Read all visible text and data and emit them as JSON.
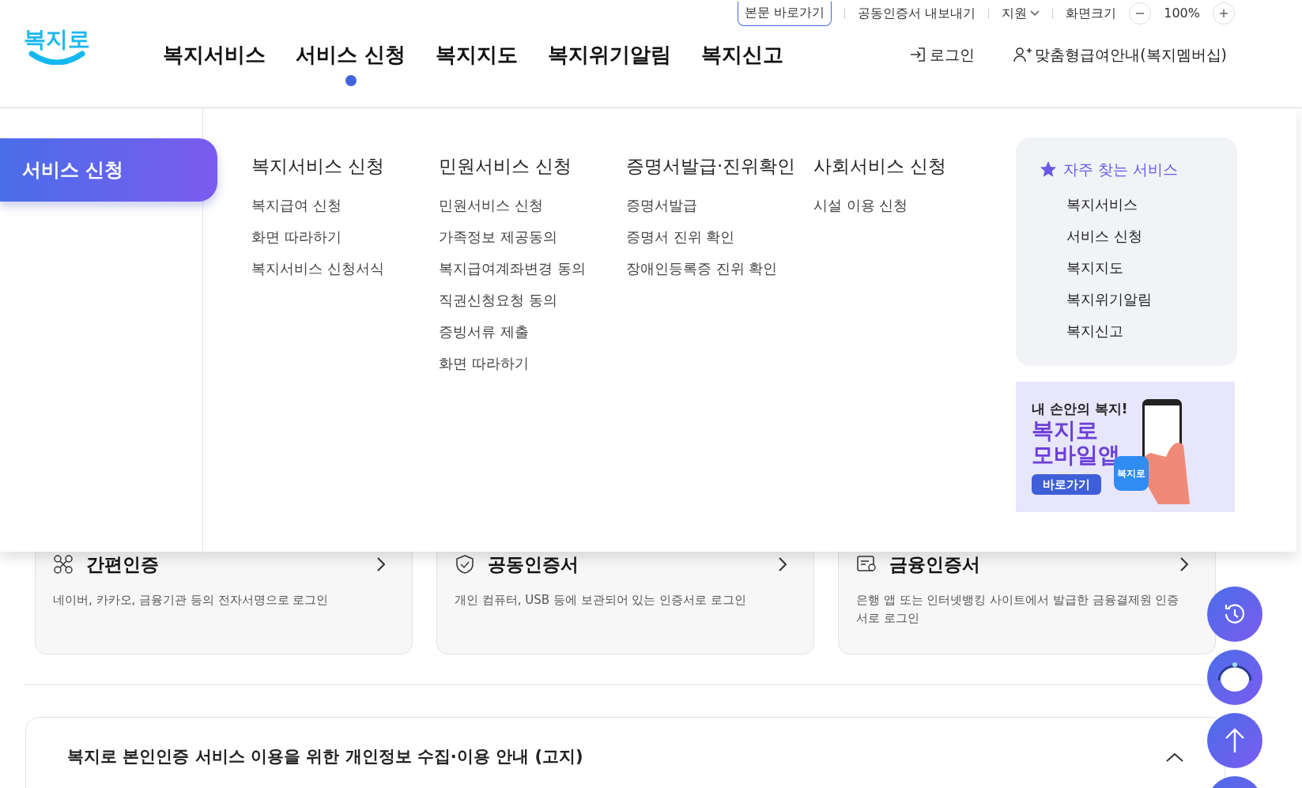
{
  "utility_bar": {
    "skip_link": "본문 바로가기",
    "export_link": "공동인증서 내보내기",
    "support": "지원",
    "zoom_label": "화면크기",
    "zoom_value": "100%"
  },
  "logo": "복지로",
  "nav": [
    {
      "label": "복지서비스",
      "selected": false
    },
    {
      "label": "서비스 신청",
      "selected": true
    },
    {
      "label": "복지지도",
      "selected": false
    },
    {
      "label": "복지위기알림",
      "selected": false
    },
    {
      "label": "복지신고",
      "selected": false
    }
  ],
  "account": [
    {
      "kind": "login",
      "label": "로그인"
    },
    {
      "kind": "member",
      "label": "맞춤형급여안내(복지멤버십)"
    }
  ],
  "mega_menu": {
    "title": "서비스 신청",
    "columns": [
      {
        "heading": "복지서비스 신청",
        "items": [
          "복지급여 신청",
          "화면 따라하기",
          "복지서비스 신청서식"
        ]
      },
      {
        "heading": "민원서비스 신청",
        "items": [
          "민원서비스 신청",
          "가족정보 제공동의",
          "복지급여계좌변경 동의",
          "직권신청요청 동의",
          "증빙서류 제출",
          "화면 따라하기"
        ]
      },
      {
        "heading": "증명서발급·진위확인",
        "items": [
          "증명서발급",
          "증명서 진위 확인",
          "장애인등록증 진위 확인"
        ]
      },
      {
        "heading": "사회서비스 신청",
        "items": [
          "시설 이용 신청"
        ]
      }
    ]
  },
  "favorites": {
    "title": "자주 찾는 서비스",
    "items": [
      "복지서비스",
      "서비스 신청",
      "복지지도",
      "복지위기알림",
      "복지신고"
    ]
  },
  "banner": {
    "kicker": "내 손안의 복지!",
    "headline": [
      "복지로",
      "모바일앱"
    ],
    "button": "바로가기",
    "app_icon": "복지로"
  },
  "login_methods": [
    {
      "kind": "simple",
      "title": "간편인증",
      "description": "네이버, 카카오, 금융기관 등의 전자서명으로 로그인"
    },
    {
      "kind": "joint",
      "title": "공동인증서",
      "description": "개인 컴퓨터, USB 등에 보관되어 있는 인증서로 로그인"
    },
    {
      "kind": "financial",
      "title": "금융인증서",
      "description": "은행 앱 또는 인터넷뱅킹 사이트에서 발급한 금융결제원 인증서로 로그인"
    }
  ],
  "notice": {
    "title": "복지로 본인인증 서비스 이용을 위한 개인정보 수집·이용 안내 (고지)",
    "expanded": true
  },
  "floating_buttons": [
    {
      "kind": "history"
    },
    {
      "kind": "chatbot"
    },
    {
      "kind": "top"
    },
    {
      "kind": "plain"
    }
  ]
}
